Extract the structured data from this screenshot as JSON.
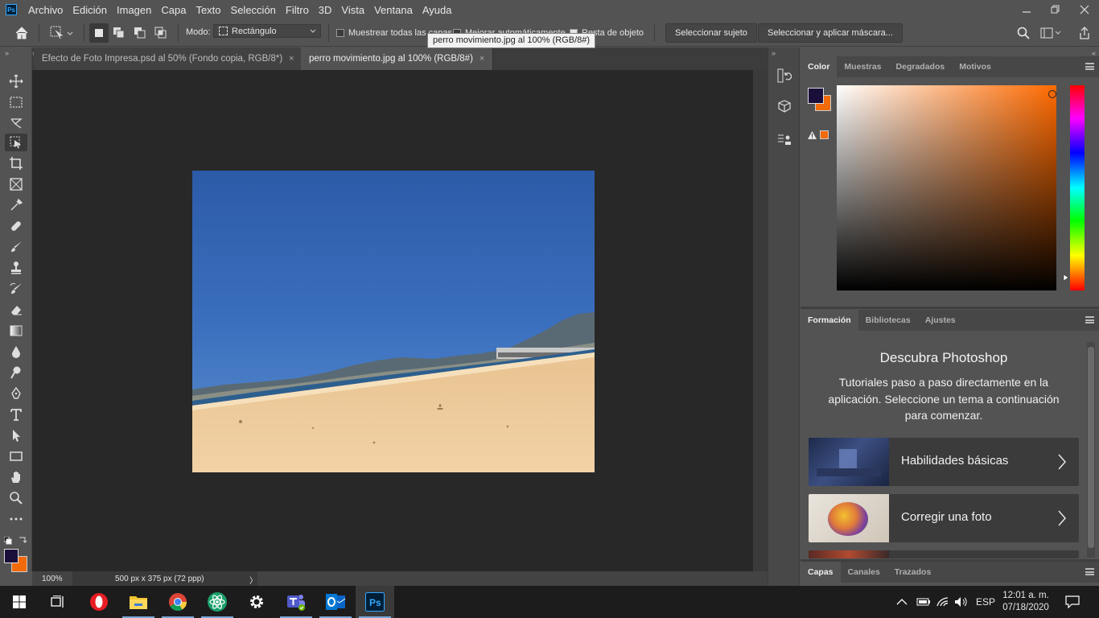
{
  "app": {
    "logo_text": "Ps",
    "menu": [
      "Archivo",
      "Edición",
      "Imagen",
      "Capa",
      "Texto",
      "Selección",
      "Filtro",
      "3D",
      "Vista",
      "Ventana",
      "Ayuda"
    ],
    "window_controls": [
      "minimize-icon",
      "restore-icon",
      "close-icon"
    ]
  },
  "options_bar": {
    "mode_label": "Modo:",
    "mode_value": "Rectángulo",
    "sample_all_layers": "Muestrear todas las capas",
    "enhance_edge": "Mejorar automáticamente",
    "object_subtract": "Resta de objeto",
    "object_subtract_checked": true,
    "select_subject": "Seleccionar sujeto",
    "select_and_mask": "Seleccionar y aplicar máscara..."
  },
  "tooltip": "perro movimiento.jpg al 100% (RGB/8#)",
  "tabs": [
    {
      "label": "Efecto de Foto Impresa.psd al 50% (Fondo copia, RGB/8*)",
      "active": false
    },
    {
      "label": "perro movimiento.jpg al 100% (RGB/8#)",
      "active": true
    }
  ],
  "tab_close": "×",
  "status": {
    "zoom": "100%",
    "doc_info": "500 px x 375 px (72 ppp)",
    "arrow": "〉"
  },
  "colors": {
    "foreground": "#1a0f3a",
    "background": "#f26a0a"
  },
  "color_panel": {
    "tabs": [
      "Color",
      "Muestras",
      "Degradados",
      "Motivos"
    ],
    "hue_color": "#ff6a00"
  },
  "learn_panel": {
    "tabs": [
      "Formación",
      "Bibliotecas",
      "Ajustes"
    ],
    "title": "Descubra Photoshop",
    "description": "Tutoriales paso a paso directamente en la aplicación. Seleccione un tema a continuación para comenzar.",
    "cards": [
      "Habilidades básicas",
      "Corregir una foto"
    ]
  },
  "layers_panel": {
    "tabs": [
      "Capas",
      "Canales",
      "Trazados"
    ]
  },
  "taskbar": {
    "apps": [
      "start-icon",
      "task-view-icon",
      "opera-icon",
      "file-explorer-icon",
      "chrome-icon",
      "atom-icon",
      "settings-icon",
      "teams-icon",
      "outlook-icon",
      "photoshop-icon"
    ],
    "lang": "ESP",
    "time": "12:01 a. m.",
    "date": "07/18/2020"
  }
}
